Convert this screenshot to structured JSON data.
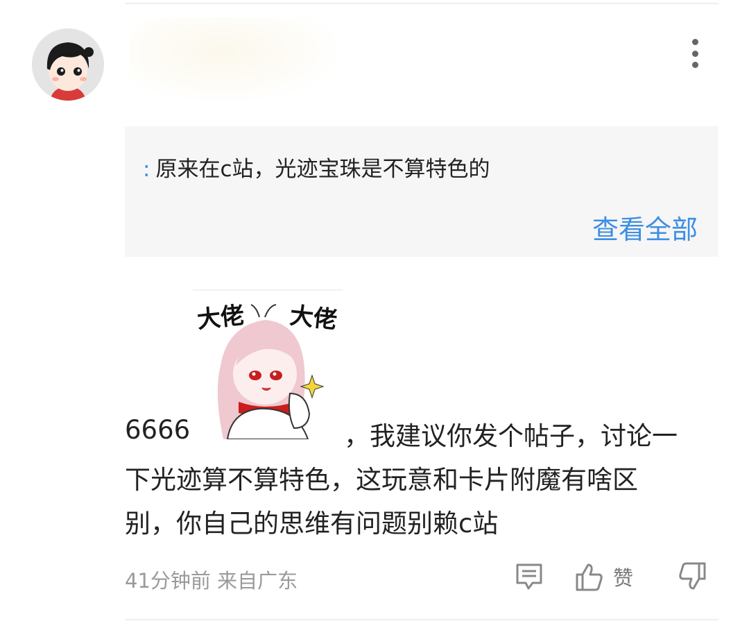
{
  "quote": {
    "colon": ":",
    "text": "原来在c站，光迹宝珠是不算特色的",
    "view_all": "查看全部"
  },
  "sticker": {
    "caption": "大佬  大佬"
  },
  "comment": {
    "line1_start": "6666",
    "line1_end": "，我建议你发个帖子，讨论一",
    "line2": "下光迹算不算特色，这玩意和卡片附魔有啥区",
    "line3": "别，你自己的思维有问题别赖c站"
  },
  "meta": {
    "time": "41分钟前",
    "location": "来自广东"
  },
  "actions": {
    "like_label": "赞"
  },
  "icons": {
    "more": "more-vertical-icon",
    "comment": "comment-icon",
    "like": "thumbs-up-icon",
    "dislike": "thumbs-down-icon"
  },
  "colors": {
    "link": "#3d8ee4",
    "quote_bg": "#f6f6f6",
    "meta_text": "#9a9a9a"
  }
}
